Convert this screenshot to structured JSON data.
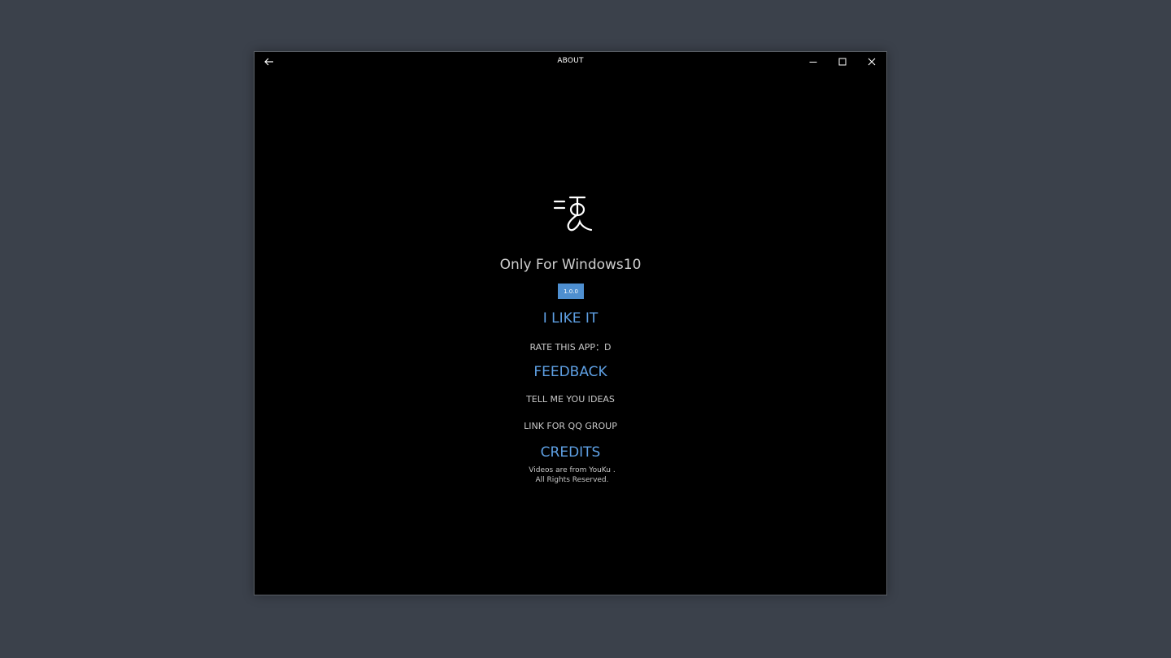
{
  "window": {
    "title": "ABOUT"
  },
  "icons": {
    "back": "arrow-left-icon",
    "minimize": "minimize-icon",
    "maximize": "maximize-icon",
    "close": "close-icon",
    "logo": "app-logo-icon"
  },
  "about": {
    "app_title": "Only For Windows10",
    "version": "1.0.0",
    "like_heading": "I LIKE IT",
    "rate_link": "RATE THIS APP：D",
    "feedback_heading": "FEEDBACK",
    "ideas_link": "TELL ME YOU IDEAS",
    "qq_link": "LINK FOR QQ GROUP",
    "credits_heading": "CREDITS",
    "credits_line1": "Videos are from  YouKu .",
    "credits_line2": "All Rights Reserved."
  },
  "colors": {
    "accent": "#5ea0e4",
    "badge": "#4e8fd0",
    "window_bg": "#000000",
    "desktop_bg": "#3b414b"
  }
}
